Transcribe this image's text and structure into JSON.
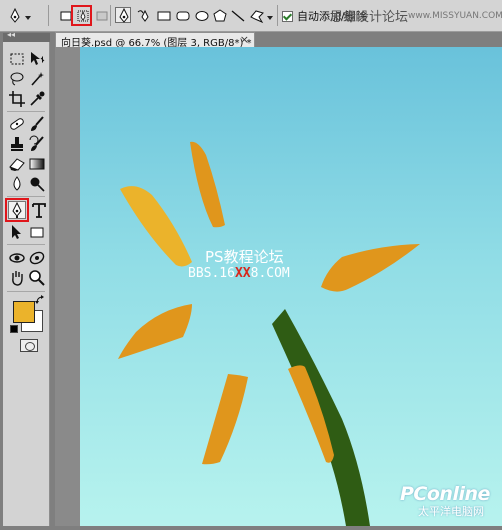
{
  "options_bar": {
    "auto_add_delete": {
      "label": "自动添加/删除",
      "checked": true
    },
    "watermark": "思缘设计论坛",
    "watermark_url": "www.MISSYUAN.COM"
  },
  "document": {
    "tab_title": "向日葵.psd @ 66.7% (图层 3, RGB/8*) *",
    "close_glyph": "×"
  },
  "toolbox": {
    "header_glyph": "◂◂",
    "foreground_color": "#ebb32b",
    "background_color": "#ffffff"
  },
  "canvas": {
    "watermark_cn": "PS教程论坛",
    "watermark_url_pre": "BBS.16",
    "watermark_url_red": "XX",
    "watermark_url_post": "8.COM",
    "logo_main": "PConline",
    "logo_sub": "太平洋电脑网",
    "colors": {
      "sky_top": "#69c2db",
      "sky_bottom": "#b7f3ee",
      "petal": "#e0961c",
      "petal_light": "#ebb32b",
      "stem": "#2f5c14"
    }
  },
  "highlights": [
    "paths-mode-button",
    "pen-tool"
  ]
}
